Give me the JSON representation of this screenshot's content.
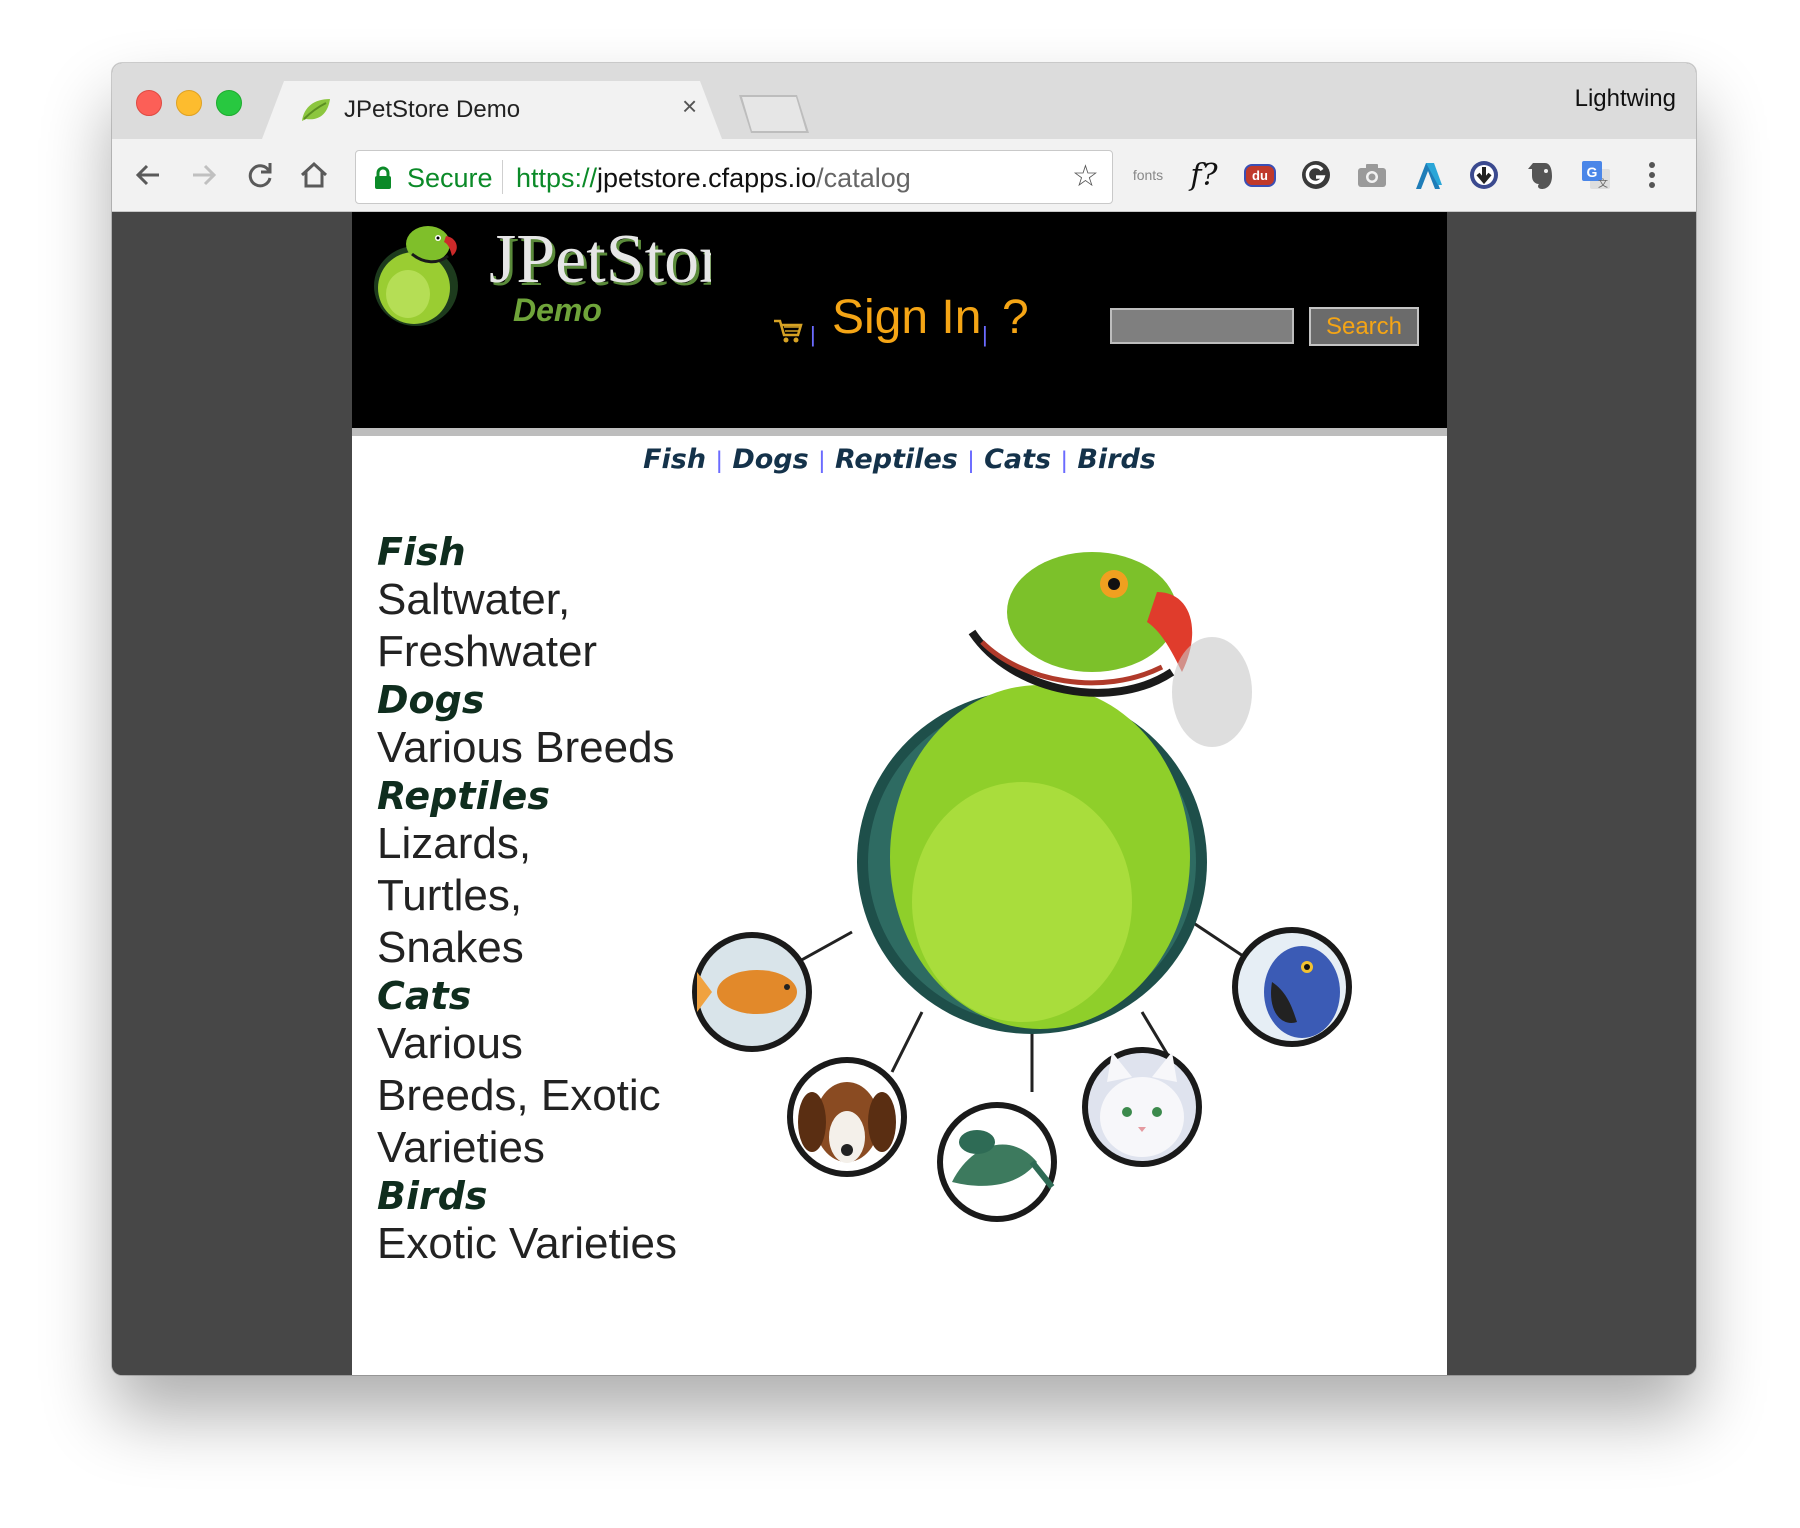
{
  "browser": {
    "tab_title": "JPetStore Demo",
    "tab_close": "×",
    "profile_name": "Lightwing",
    "secure_label": "Secure",
    "url_scheme": "https://",
    "url_host": "jpetstore.cfapps.io",
    "url_path": "/catalog",
    "extensions": [
      "fonts",
      "f?",
      "du"
    ]
  },
  "header": {
    "logo_title": "JPetStore",
    "logo_subtitle": "Demo",
    "sign_in": "Sign In",
    "help": "?",
    "search_value": "",
    "search_button": "Search"
  },
  "quicklinks": [
    "Fish",
    "Dogs",
    "Reptiles",
    "Cats",
    "Birds"
  ],
  "sidebar": [
    {
      "title": "Fish",
      "desc": "Saltwater, Freshwater"
    },
    {
      "title": "Dogs",
      "desc": "Various Breeds"
    },
    {
      "title": "Reptiles",
      "desc": "Lizards, Turtles, Snakes"
    },
    {
      "title": "Cats",
      "desc": "Various Breeds, Exotic Varieties"
    },
    {
      "title": "Birds",
      "desc": "Exotic Varieties"
    }
  ],
  "colors": {
    "brand_orange": "#f5a515",
    "header_bg": "#000000",
    "page_bg": "#474747",
    "secure_green": "#0b8a28"
  }
}
